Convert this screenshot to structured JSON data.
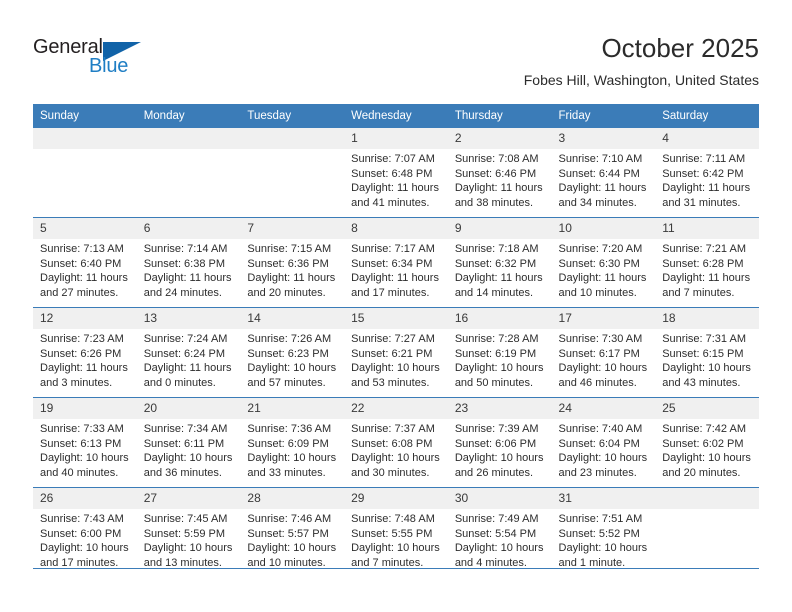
{
  "brand": {
    "name_part1": "General",
    "name_part2": "Blue",
    "triangle_icon": "triangle-icon",
    "colors": {
      "dark": "#231f20",
      "blue": "#1f7ec4",
      "triangle": "#1163a8"
    }
  },
  "header": {
    "title": "October 2025",
    "location": "Fobes Hill, Washington, United States"
  },
  "theme": {
    "header_blue": "#3b7cb8",
    "daynum_band": "#f0f0f0",
    "text": "#2d2d2d"
  },
  "calendar": {
    "weekday_headers": [
      "Sunday",
      "Monday",
      "Tuesday",
      "Wednesday",
      "Thursday",
      "Friday",
      "Saturday"
    ],
    "weeks": [
      [
        {
          "day": "",
          "empty": true,
          "sunrise": "",
          "sunset": "",
          "daylight_line1": "",
          "daylight_line2": ""
        },
        {
          "day": "",
          "empty": true,
          "sunrise": "",
          "sunset": "",
          "daylight_line1": "",
          "daylight_line2": ""
        },
        {
          "day": "",
          "empty": true,
          "sunrise": "",
          "sunset": "",
          "daylight_line1": "",
          "daylight_line2": ""
        },
        {
          "day": "1",
          "empty": false,
          "sunrise": "Sunrise: 7:07 AM",
          "sunset": "Sunset: 6:48 PM",
          "daylight_line1": "Daylight: 11 hours",
          "daylight_line2": "and 41 minutes."
        },
        {
          "day": "2",
          "empty": false,
          "sunrise": "Sunrise: 7:08 AM",
          "sunset": "Sunset: 6:46 PM",
          "daylight_line1": "Daylight: 11 hours",
          "daylight_line2": "and 38 minutes."
        },
        {
          "day": "3",
          "empty": false,
          "sunrise": "Sunrise: 7:10 AM",
          "sunset": "Sunset: 6:44 PM",
          "daylight_line1": "Daylight: 11 hours",
          "daylight_line2": "and 34 minutes."
        },
        {
          "day": "4",
          "empty": false,
          "sunrise": "Sunrise: 7:11 AM",
          "sunset": "Sunset: 6:42 PM",
          "daylight_line1": "Daylight: 11 hours",
          "daylight_line2": "and 31 minutes."
        }
      ],
      [
        {
          "day": "5",
          "empty": false,
          "sunrise": "Sunrise: 7:13 AM",
          "sunset": "Sunset: 6:40 PM",
          "daylight_line1": "Daylight: 11 hours",
          "daylight_line2": "and 27 minutes."
        },
        {
          "day": "6",
          "empty": false,
          "sunrise": "Sunrise: 7:14 AM",
          "sunset": "Sunset: 6:38 PM",
          "daylight_line1": "Daylight: 11 hours",
          "daylight_line2": "and 24 minutes."
        },
        {
          "day": "7",
          "empty": false,
          "sunrise": "Sunrise: 7:15 AM",
          "sunset": "Sunset: 6:36 PM",
          "daylight_line1": "Daylight: 11 hours",
          "daylight_line2": "and 20 minutes."
        },
        {
          "day": "8",
          "empty": false,
          "sunrise": "Sunrise: 7:17 AM",
          "sunset": "Sunset: 6:34 PM",
          "daylight_line1": "Daylight: 11 hours",
          "daylight_line2": "and 17 minutes."
        },
        {
          "day": "9",
          "empty": false,
          "sunrise": "Sunrise: 7:18 AM",
          "sunset": "Sunset: 6:32 PM",
          "daylight_line1": "Daylight: 11 hours",
          "daylight_line2": "and 14 minutes."
        },
        {
          "day": "10",
          "empty": false,
          "sunrise": "Sunrise: 7:20 AM",
          "sunset": "Sunset: 6:30 PM",
          "daylight_line1": "Daylight: 11 hours",
          "daylight_line2": "and 10 minutes."
        },
        {
          "day": "11",
          "empty": false,
          "sunrise": "Sunrise: 7:21 AM",
          "sunset": "Sunset: 6:28 PM",
          "daylight_line1": "Daylight: 11 hours",
          "daylight_line2": "and 7 minutes."
        }
      ],
      [
        {
          "day": "12",
          "empty": false,
          "sunrise": "Sunrise: 7:23 AM",
          "sunset": "Sunset: 6:26 PM",
          "daylight_line1": "Daylight: 11 hours",
          "daylight_line2": "and 3 minutes."
        },
        {
          "day": "13",
          "empty": false,
          "sunrise": "Sunrise: 7:24 AM",
          "sunset": "Sunset: 6:24 PM",
          "daylight_line1": "Daylight: 11 hours",
          "daylight_line2": "and 0 minutes."
        },
        {
          "day": "14",
          "empty": false,
          "sunrise": "Sunrise: 7:26 AM",
          "sunset": "Sunset: 6:23 PM",
          "daylight_line1": "Daylight: 10 hours",
          "daylight_line2": "and 57 minutes."
        },
        {
          "day": "15",
          "empty": false,
          "sunrise": "Sunrise: 7:27 AM",
          "sunset": "Sunset: 6:21 PM",
          "daylight_line1": "Daylight: 10 hours",
          "daylight_line2": "and 53 minutes."
        },
        {
          "day": "16",
          "empty": false,
          "sunrise": "Sunrise: 7:28 AM",
          "sunset": "Sunset: 6:19 PM",
          "daylight_line1": "Daylight: 10 hours",
          "daylight_line2": "and 50 minutes."
        },
        {
          "day": "17",
          "empty": false,
          "sunrise": "Sunrise: 7:30 AM",
          "sunset": "Sunset: 6:17 PM",
          "daylight_line1": "Daylight: 10 hours",
          "daylight_line2": "and 46 minutes."
        },
        {
          "day": "18",
          "empty": false,
          "sunrise": "Sunrise: 7:31 AM",
          "sunset": "Sunset: 6:15 PM",
          "daylight_line1": "Daylight: 10 hours",
          "daylight_line2": "and 43 minutes."
        }
      ],
      [
        {
          "day": "19",
          "empty": false,
          "sunrise": "Sunrise: 7:33 AM",
          "sunset": "Sunset: 6:13 PM",
          "daylight_line1": "Daylight: 10 hours",
          "daylight_line2": "and 40 minutes."
        },
        {
          "day": "20",
          "empty": false,
          "sunrise": "Sunrise: 7:34 AM",
          "sunset": "Sunset: 6:11 PM",
          "daylight_line1": "Daylight: 10 hours",
          "daylight_line2": "and 36 minutes."
        },
        {
          "day": "21",
          "empty": false,
          "sunrise": "Sunrise: 7:36 AM",
          "sunset": "Sunset: 6:09 PM",
          "daylight_line1": "Daylight: 10 hours",
          "daylight_line2": "and 33 minutes."
        },
        {
          "day": "22",
          "empty": false,
          "sunrise": "Sunrise: 7:37 AM",
          "sunset": "Sunset: 6:08 PM",
          "daylight_line1": "Daylight: 10 hours",
          "daylight_line2": "and 30 minutes."
        },
        {
          "day": "23",
          "empty": false,
          "sunrise": "Sunrise: 7:39 AM",
          "sunset": "Sunset: 6:06 PM",
          "daylight_line1": "Daylight: 10 hours",
          "daylight_line2": "and 26 minutes."
        },
        {
          "day": "24",
          "empty": false,
          "sunrise": "Sunrise: 7:40 AM",
          "sunset": "Sunset: 6:04 PM",
          "daylight_line1": "Daylight: 10 hours",
          "daylight_line2": "and 23 minutes."
        },
        {
          "day": "25",
          "empty": false,
          "sunrise": "Sunrise: 7:42 AM",
          "sunset": "Sunset: 6:02 PM",
          "daylight_line1": "Daylight: 10 hours",
          "daylight_line2": "and 20 minutes."
        }
      ],
      [
        {
          "day": "26",
          "empty": false,
          "sunrise": "Sunrise: 7:43 AM",
          "sunset": "Sunset: 6:00 PM",
          "daylight_line1": "Daylight: 10 hours",
          "daylight_line2": "and 17 minutes."
        },
        {
          "day": "27",
          "empty": false,
          "sunrise": "Sunrise: 7:45 AM",
          "sunset": "Sunset: 5:59 PM",
          "daylight_line1": "Daylight: 10 hours",
          "daylight_line2": "and 13 minutes."
        },
        {
          "day": "28",
          "empty": false,
          "sunrise": "Sunrise: 7:46 AM",
          "sunset": "Sunset: 5:57 PM",
          "daylight_line1": "Daylight: 10 hours",
          "daylight_line2": "and 10 minutes."
        },
        {
          "day": "29",
          "empty": false,
          "sunrise": "Sunrise: 7:48 AM",
          "sunset": "Sunset: 5:55 PM",
          "daylight_line1": "Daylight: 10 hours",
          "daylight_line2": "and 7 minutes."
        },
        {
          "day": "30",
          "empty": false,
          "sunrise": "Sunrise: 7:49 AM",
          "sunset": "Sunset: 5:54 PM",
          "daylight_line1": "Daylight: 10 hours",
          "daylight_line2": "and 4 minutes."
        },
        {
          "day": "31",
          "empty": false,
          "sunrise": "Sunrise: 7:51 AM",
          "sunset": "Sunset: 5:52 PM",
          "daylight_line1": "Daylight: 10 hours",
          "daylight_line2": "and 1 minute."
        },
        {
          "day": "",
          "empty": true,
          "sunrise": "",
          "sunset": "",
          "daylight_line1": "",
          "daylight_line2": ""
        }
      ]
    ]
  }
}
